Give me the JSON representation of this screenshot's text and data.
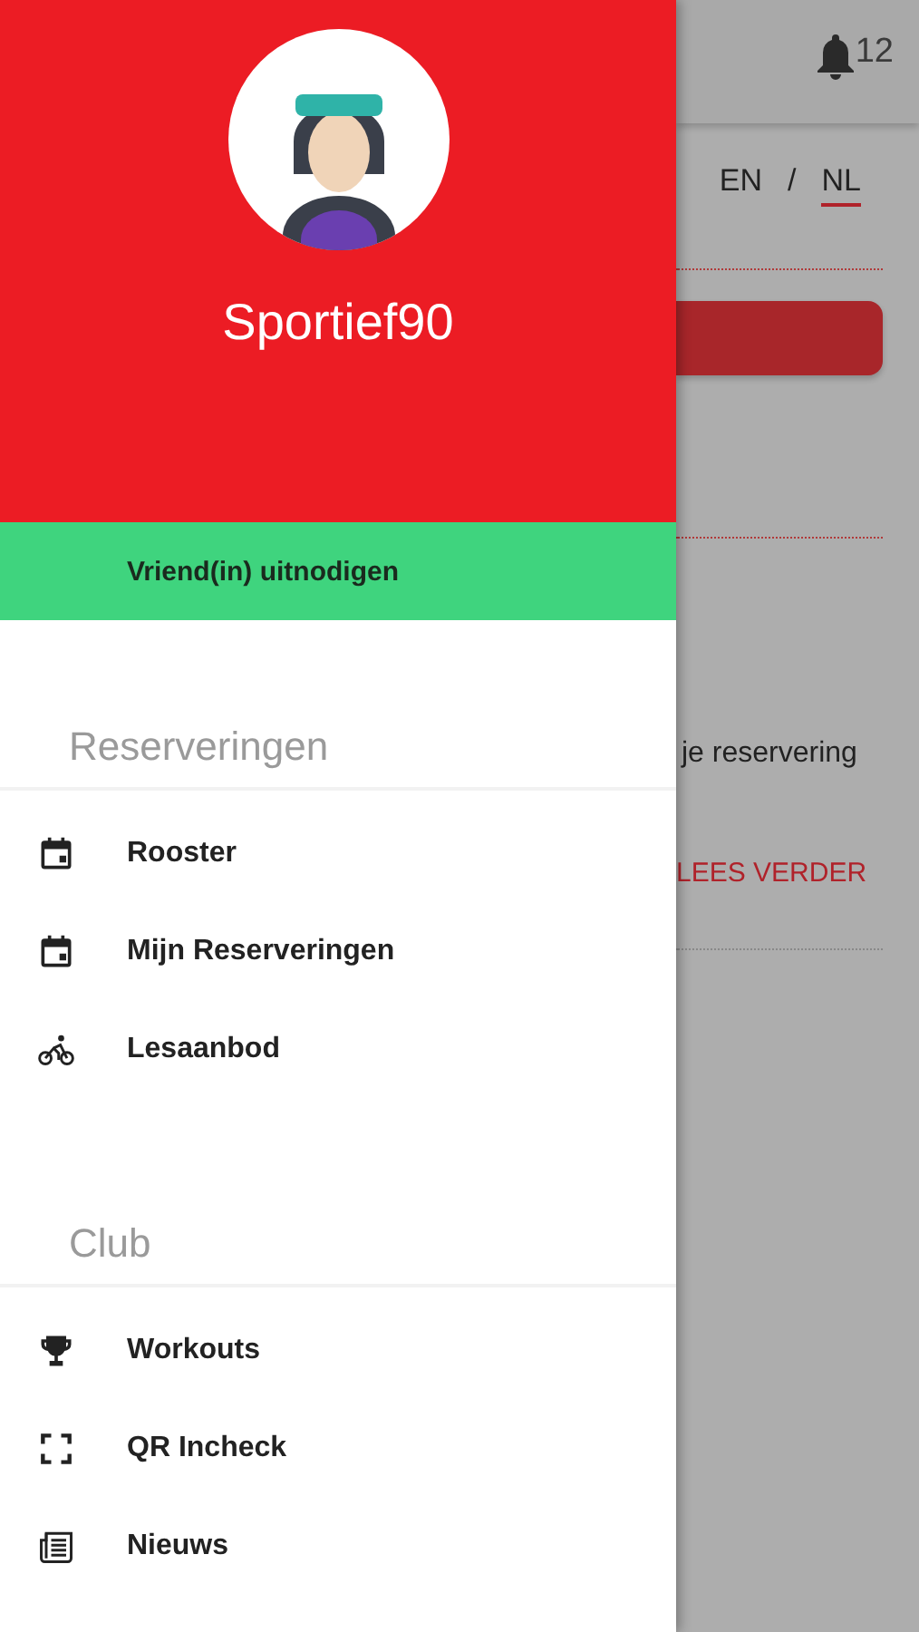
{
  "drawer": {
    "username": "Sportief90",
    "invite_button": "Vriend(in) uitnodigen",
    "sections": [
      {
        "title": "Reserveringen",
        "items": [
          {
            "label": "Rooster",
            "kind": "calendar"
          },
          {
            "label": "Mijn Reserveringen",
            "kind": "calendar"
          },
          {
            "label": "Lesaanbod",
            "kind": "bike"
          }
        ]
      },
      {
        "title": "Club",
        "items": [
          {
            "label": "Workouts",
            "kind": "trophy"
          },
          {
            "label": "QR Incheck",
            "kind": "scan"
          },
          {
            "label": "Nieuws",
            "kind": "news"
          }
        ]
      }
    ]
  },
  "background": {
    "notification_count": "12",
    "languages": [
      {
        "label": "EN",
        "selected": false
      },
      {
        "label": "NL",
        "selected": true
      }
    ],
    "language_separator": "/",
    "text": "je reservering",
    "link": "LEES VERDER"
  }
}
